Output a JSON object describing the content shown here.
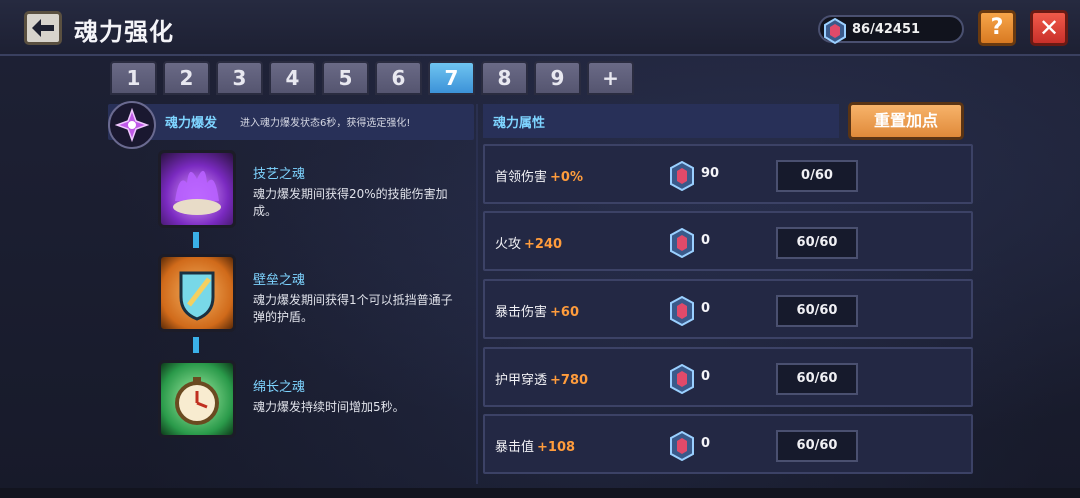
{
  "header": {
    "title": "魂力强化",
    "currency_amount": "86/42451",
    "help_label": "?",
    "close_label": "✕"
  },
  "tabs": [
    {
      "label": "1"
    },
    {
      "label": "2"
    },
    {
      "label": "3"
    },
    {
      "label": "4"
    },
    {
      "label": "5"
    },
    {
      "label": "6"
    },
    {
      "label": "7",
      "active": true
    },
    {
      "label": "8"
    },
    {
      "label": "9"
    },
    {
      "label": "+"
    }
  ],
  "burst": {
    "label": "魂力爆发",
    "description": "进入魂力爆发状态6秒，获得选定强化!"
  },
  "skills": [
    {
      "name": "技艺之魂",
      "description": "魂力爆发期间获得20%的技能伤害加成。",
      "icon": "purple-flame-icon"
    },
    {
      "name": "壁垒之魂",
      "description": "魂力爆发期间获得1个可以抵挡普通子弹的护盾。",
      "icon": "shield-icon"
    },
    {
      "name": "绵长之魂",
      "description": "魂力爆发持续时间增加5秒。",
      "icon": "clock-icon"
    }
  ],
  "attributes": {
    "title": "魂力属性",
    "reset_label": "重置加点",
    "rows": [
      {
        "name": "首领伤害",
        "bonus": "+0%",
        "cost": "90",
        "level": "0/60"
      },
      {
        "name": "火攻",
        "bonus": "+240",
        "cost": "0",
        "level": "60/60"
      },
      {
        "name": "暴击伤害",
        "bonus": "+60",
        "cost": "0",
        "level": "60/60"
      },
      {
        "name": "护甲穿透",
        "bonus": "+780",
        "cost": "0",
        "level": "60/60"
      },
      {
        "name": "暴击值",
        "bonus": "+108",
        "cost": "0",
        "level": "60/60"
      }
    ]
  },
  "colors": {
    "accent_blue": "#7ed4ff",
    "bonus_orange": "#ff9c3c",
    "active_tab": "#3c92d8"
  }
}
